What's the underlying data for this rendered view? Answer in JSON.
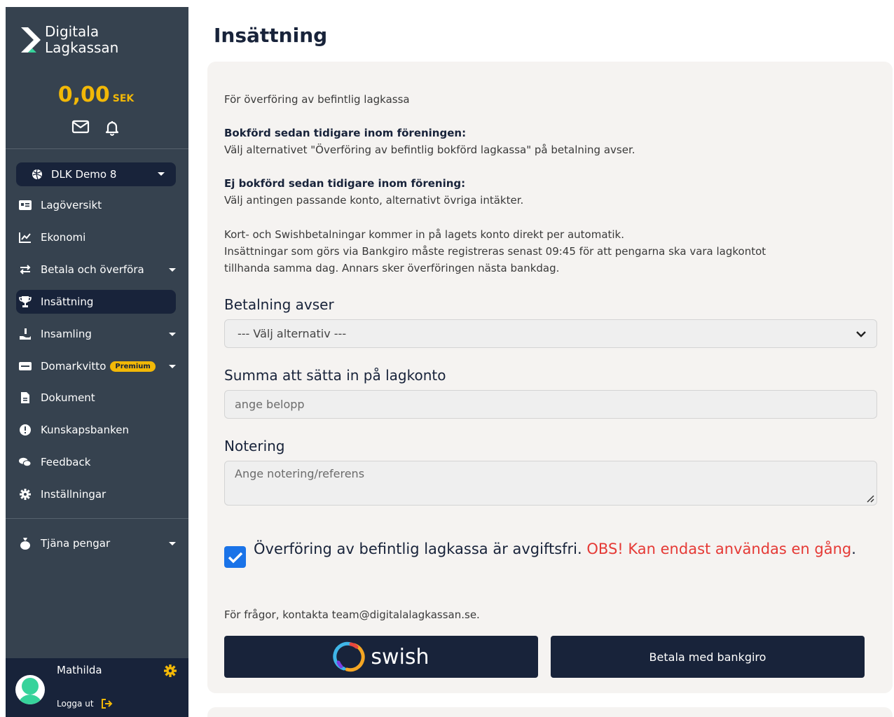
{
  "sidebar": {
    "brand": {
      "line1": "Digitala",
      "line2": "Lagkassan"
    },
    "balance": {
      "amount": "0,00",
      "currency": "SEK"
    },
    "team": {
      "name": "DLK Demo 8"
    },
    "items": [
      {
        "label": "Lagöversikt"
      },
      {
        "label": "Ekonomi"
      },
      {
        "label": "Betala och överföra"
      },
      {
        "label": "Insättning"
      },
      {
        "label": "Insamling"
      },
      {
        "label": "Domarkvitto",
        "badge": "Premium"
      },
      {
        "label": "Dokument"
      },
      {
        "label": "Kunskapsbanken"
      },
      {
        "label": "Feedback"
      },
      {
        "label": "Inställningar"
      }
    ],
    "earn": {
      "label": "Tjäna pengar"
    },
    "user": {
      "name": "Mathilda",
      "logout": "Logga ut"
    }
  },
  "main": {
    "title": "Insättning",
    "intro": "För överföring av befintlig lagkassa",
    "section1": {
      "heading": "Bokförd sedan tidigare inom föreningen:",
      "text": "Välj alternativet \"Överföring av befintlig bokförd lagkassa\" på betalning avser."
    },
    "section2": {
      "heading": "Ej bokförd sedan tidigare inom förening:",
      "text": "Välj antingen passande konto, alternativt övriga intäkter."
    },
    "info": {
      "line1": "Kort- och Swishbetalningar kommer in på lagets konto direkt per automatik.",
      "line2": "Insättningar som görs via Bankgiro måste registreras senast 09:45 för att pengarna ska vara lagkontot",
      "line3": "tillhanda samma dag. Annars sker överföringen nästa bankdag."
    },
    "payment_for": {
      "label": "Betalning avser",
      "selected": "--- Välj alternativ ---"
    },
    "amount": {
      "label": "Summa att sätta in på lagkonto",
      "placeholder": "ange belopp"
    },
    "note": {
      "label": "Notering",
      "placeholder": "Ange notering/referens"
    },
    "consent": {
      "text": "Överföring av befintlig lagkassa är avgiftsfri.",
      "warning": "OBS! Kan endast användas en gång",
      "end": "."
    },
    "contact": "För frågor, kontakta team@digitalalagkassan.se.",
    "buttons": {
      "swish": "swish",
      "bankgiro": "Betala med bankgiro"
    }
  },
  "colors": {
    "sidebar": "#36424f",
    "navy": "#18233a",
    "accent": "#f2b807",
    "warning": "#e53935",
    "checkbox": "#1a73e8",
    "panel": "#f5f3f1"
  }
}
